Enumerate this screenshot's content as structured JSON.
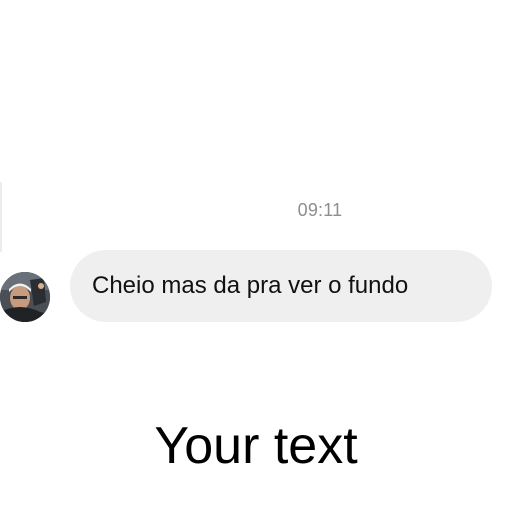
{
  "conversation": {
    "timestamp": "09:11",
    "messages": [
      {
        "text": "Cheio mas da pra ver o fundo",
        "sender": "other"
      }
    ]
  },
  "overlay": {
    "caption": "Your text"
  },
  "colors": {
    "bubble": "#efefef",
    "timestamp": "#8e8e8e",
    "text": "#111111",
    "background": "#ffffff"
  }
}
